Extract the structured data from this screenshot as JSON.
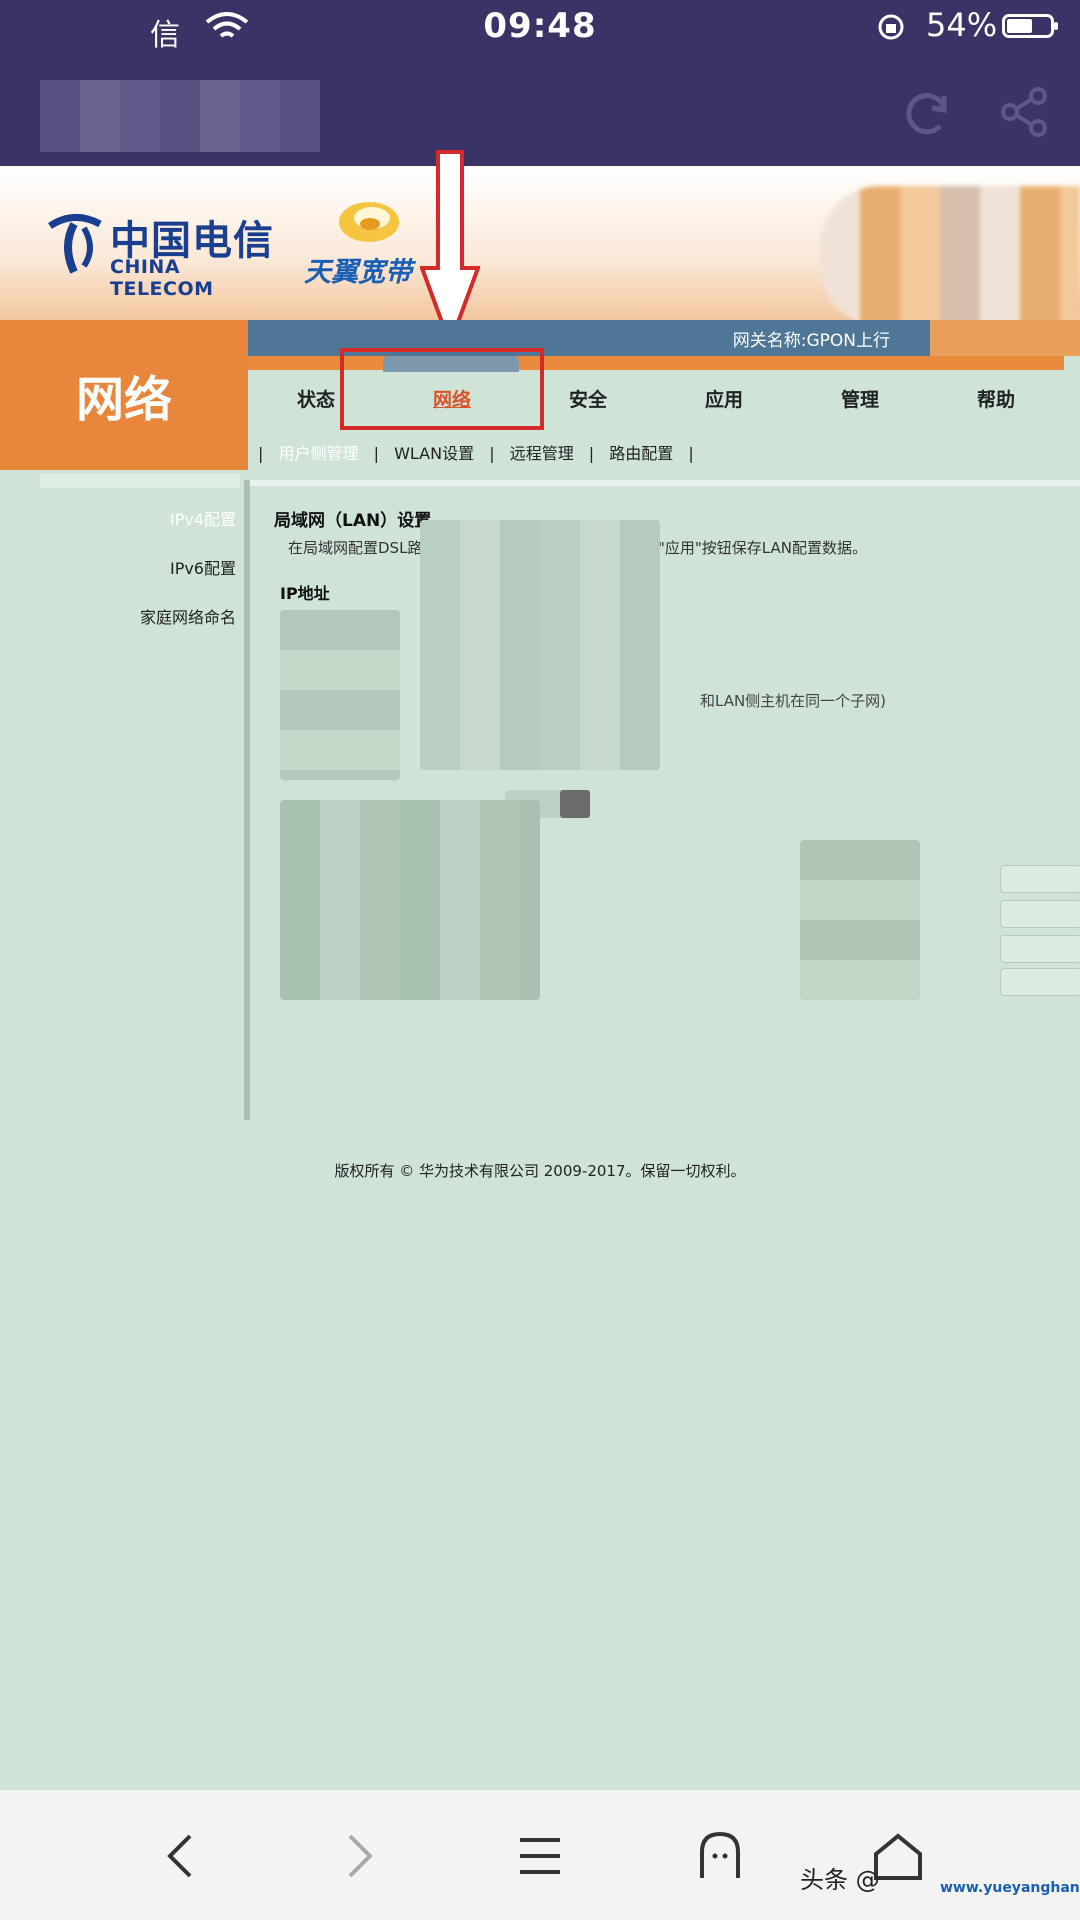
{
  "status_bar": {
    "carrier": "信",
    "time": "09:48",
    "battery": "54%"
  },
  "header": {
    "logo_cn": "中国电信",
    "logo_en": "CHINA TELECOM",
    "tianyi": "天翼宽带",
    "gateway_name": "网关名称:GPON上行"
  },
  "section_title": "网络",
  "tabs": [
    {
      "label": "状态"
    },
    {
      "label": "网络"
    },
    {
      "label": "安全"
    },
    {
      "label": "应用"
    },
    {
      "label": "管理"
    },
    {
      "label": "帮助"
    }
  ],
  "subnav": {
    "sep": "|",
    "items": [
      "用户侧管理",
      "WLAN设置",
      "远程管理",
      "路由配置"
    ]
  },
  "left_menu": [
    "IPv4配置",
    "IPv6配置",
    "家庭网络命名"
  ],
  "content": {
    "lan_title": "局域网（LAN）设置",
    "lan_desc_a": "在局域网配置DSL路",
    "lan_desc_b": "\"应用\"按钮保存LAN配置数据。",
    "ip_title": "IP地址",
    "subnet_note": "和LAN侧主机在同一个子网)"
  },
  "footer": "版权所有 © 华为技术有限公司 2009-2017。保留一切权利。",
  "watermark": {
    "text": "头条 @",
    "site": "www.yueyanghang.com"
  },
  "colors": {
    "accent_orange": "#e8873c",
    "gateway_blue": "#4e7797",
    "highlight_red": "#d52a2a",
    "page_bg": "#cfe3d6"
  }
}
